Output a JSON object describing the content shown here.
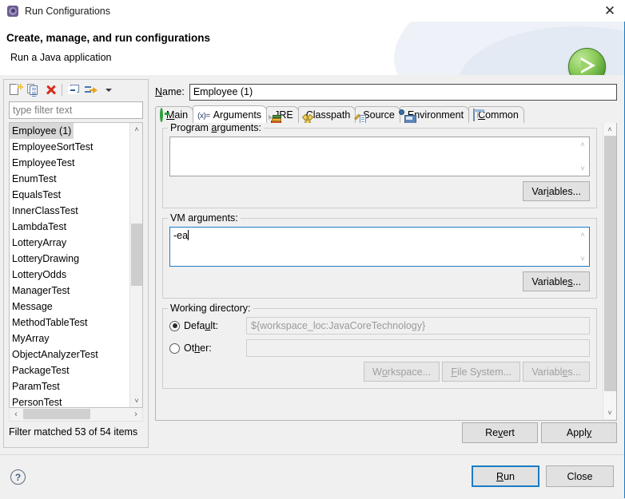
{
  "window": {
    "title": "Run Configurations",
    "title_icon": "run-configurations-icon",
    "close_label": "✕"
  },
  "header": {
    "title": "Create, manage, and run configurations",
    "subtitle": "Run a Java application",
    "icon": "green-run-ball-icon"
  },
  "left_panel": {
    "toolbar": [
      {
        "name": "new-configuration-button",
        "tooltip": "New launch configuration"
      },
      {
        "name": "duplicate-configuration-button",
        "tooltip": "Duplicate"
      },
      {
        "name": "delete-configuration-button",
        "tooltip": "Delete"
      },
      {
        "name": "collapse-all-button",
        "tooltip": "Collapse All"
      },
      {
        "name": "filter-button",
        "tooltip": "Filter"
      },
      {
        "name": "view-menu-button",
        "tooltip": "View Menu"
      }
    ],
    "filter": {
      "placeholder": "type filter text",
      "value": ""
    },
    "items": [
      "Employee (1)",
      "EmployeeSortTest",
      "EmployeeTest",
      "EnumTest",
      "EqualsTest",
      "InnerClassTest",
      "LambdaTest",
      "LotteryArray",
      "LotteryDrawing",
      "LotteryOdds",
      "ManagerTest",
      "Message",
      "MethodTableTest",
      "MyArray",
      "ObjectAnalyzerTest",
      "PackageTest",
      "ParamTest",
      "PersonTest"
    ],
    "selected_item": "Employee (1)",
    "status": "Filter matched 53 of 54 items",
    "scroll_left_arrow": "‹",
    "scroll_right_arrow": "›",
    "scroll_up_arrow": "˄",
    "scroll_down_arrow": "˅"
  },
  "right_panel": {
    "name_label_pre": "N",
    "name_label_accel": "a",
    "name_label_post": "me:",
    "name_value": "Employee (1)",
    "tabs": [
      {
        "label": "Main",
        "icon": "main-tab-icon",
        "active": false
      },
      {
        "label": "Arguments",
        "icon": "arguments-tab-icon",
        "active": true
      },
      {
        "label": "JRE",
        "icon": "jre-tab-icon",
        "active": false
      },
      {
        "label": "Classpath",
        "icon": "classpath-tab-icon",
        "active": false
      },
      {
        "label": "Source",
        "icon": "source-tab-icon",
        "active": false
      },
      {
        "label": "Environment",
        "icon": "environment-tab-icon",
        "active": false
      },
      {
        "label": "Common",
        "icon": "common-tab-icon",
        "active": false
      }
    ],
    "program_arguments": {
      "legend_pre": "Program ",
      "legend_accel": "a",
      "legend_post": "rguments:",
      "value": "",
      "variables_button": "Variables..."
    },
    "vm_arguments": {
      "legend": "VM arguments:",
      "value": "-ea",
      "variables_button_pre": "Variable",
      "variables_button_accel": "s",
      "variables_button_post": "..."
    },
    "working_directory": {
      "legend": "Working directory:",
      "default_label_pre": "Defa",
      "default_label_accel": "u",
      "default_label_post": "lt:",
      "default_value": "${workspace_loc:JavaCoreTechnology}",
      "default_selected": true,
      "other_label_pre": "Ot",
      "other_label_accel": "h",
      "other_label_post": "er:",
      "other_value": "",
      "other_selected": false,
      "workspace_button_pre": "W",
      "workspace_button_accel": "o",
      "workspace_button_post": "rkspace...",
      "filesystem_button_pre": "",
      "filesystem_button_accel": "F",
      "filesystem_button_post": "ile System...",
      "variables_button_pre": "Variabl",
      "variables_button_accel": "e",
      "variables_button_post": "s..."
    },
    "revert_button_pre": "Re",
    "revert_button_accel": "v",
    "revert_button_post": "ert",
    "apply_button_pre": "Appl",
    "apply_button_accel": "y",
    "apply_button_post": ""
  },
  "footer": {
    "help_icon": "help-question-icon",
    "help_glyph": "?",
    "run_button_pre": "",
    "run_button_accel": "R",
    "run_button_post": "un",
    "close_button": "Close"
  },
  "colors": {
    "accent_blue": "#1a7cc7",
    "dialog_bg": "#f0f0f0",
    "selection_gray": "#d8d8d8",
    "run_green": "#4e9a2f",
    "delete_red": "#d62c1a"
  }
}
